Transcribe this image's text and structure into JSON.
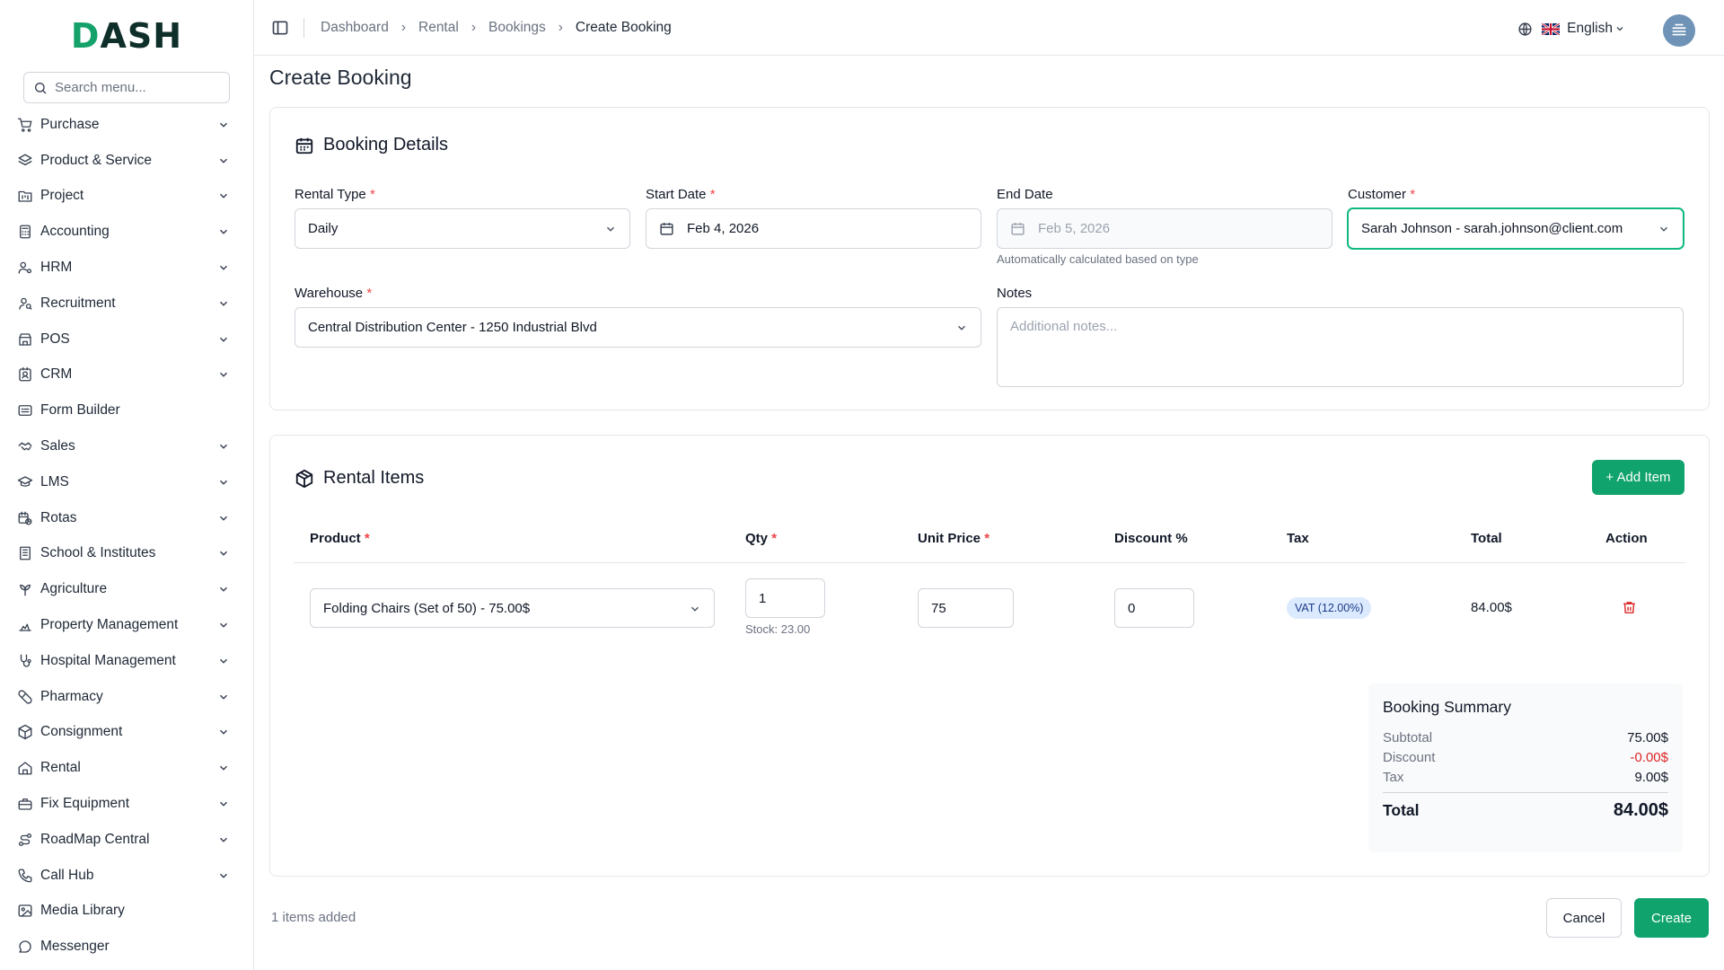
{
  "sidebar": {
    "logo": "DASH",
    "search_placeholder": "Search menu...",
    "items": [
      {
        "label": "Purchase",
        "icon": "cart-icon",
        "expandable": true
      },
      {
        "label": "Product & Service",
        "icon": "layers-icon",
        "expandable": true
      },
      {
        "label": "Project",
        "icon": "folder-kanban-icon",
        "expandable": true
      },
      {
        "label": "Accounting",
        "icon": "calculator-icon",
        "expandable": true
      },
      {
        "label": "HRM",
        "icon": "users-cog-icon",
        "expandable": true
      },
      {
        "label": "Recruitment",
        "icon": "user-search-icon",
        "expandable": true
      },
      {
        "label": "POS",
        "icon": "store-icon",
        "expandable": true
      },
      {
        "label": "CRM",
        "icon": "contact-icon",
        "expandable": true
      },
      {
        "label": "Form Builder",
        "icon": "form-icon",
        "expandable": false
      },
      {
        "label": "Sales",
        "icon": "handshake-icon",
        "expandable": true
      },
      {
        "label": "LMS",
        "icon": "graduation-cap-icon",
        "expandable": true
      },
      {
        "label": "Rotas",
        "icon": "calendar-clock-icon",
        "expandable": true
      },
      {
        "label": "School & Institutes",
        "icon": "school-icon",
        "expandable": true
      },
      {
        "label": "Agriculture",
        "icon": "sprout-icon",
        "expandable": true
      },
      {
        "label": "Property Management",
        "icon": "building-icon",
        "expandable": true
      },
      {
        "label": "Hospital Management",
        "icon": "stethoscope-icon",
        "expandable": true
      },
      {
        "label": "Pharmacy",
        "icon": "pill-icon",
        "expandable": true
      },
      {
        "label": "Consignment",
        "icon": "package-icon",
        "expandable": true
      },
      {
        "label": "Rental",
        "icon": "home-icon",
        "expandable": true
      },
      {
        "label": "Fix Equipment",
        "icon": "toolbox-icon",
        "expandable": true
      },
      {
        "label": "RoadMap Central",
        "icon": "route-icon",
        "expandable": true
      },
      {
        "label": "Call Hub",
        "icon": "phone-icon",
        "expandable": true
      },
      {
        "label": "Media Library",
        "icon": "image-icon",
        "expandable": false
      },
      {
        "label": "Messenger",
        "icon": "message-icon",
        "expandable": false
      }
    ]
  },
  "header": {
    "breadcrumbs": [
      "Dashboard",
      "Rental",
      "Bookings",
      "Create Booking"
    ],
    "language": "English"
  },
  "page": {
    "title": "Create Booking"
  },
  "booking_details": {
    "title": "Booking Details",
    "rental_type": {
      "label": "Rental Type",
      "value": "Daily"
    },
    "start_date": {
      "label": "Start Date",
      "value": "Feb 4, 2026"
    },
    "end_date": {
      "label": "End Date",
      "value": "Feb 5, 2026",
      "hint": "Automatically calculated based on type"
    },
    "customer": {
      "label": "Customer",
      "value": "Sarah Johnson - sarah.johnson@client.com"
    },
    "warehouse": {
      "label": "Warehouse",
      "value": "Central Distribution Center - 1250 Industrial Blvd"
    },
    "notes": {
      "label": "Notes",
      "placeholder": "Additional notes..."
    }
  },
  "rental_items": {
    "title": "Rental Items",
    "add_button": "+ Add Item",
    "columns": {
      "product": "Product",
      "qty": "Qty",
      "unit_price": "Unit Price",
      "discount": "Discount %",
      "tax": "Tax",
      "total": "Total",
      "action": "Action"
    },
    "rows": [
      {
        "product": "Folding Chairs (Set of 50) - 75.00$",
        "qty": "1",
        "stock": "Stock: 23.00",
        "unit_price": "75",
        "discount": "0",
        "tax": "VAT (12.00%)",
        "total": "84.00$"
      }
    ]
  },
  "summary": {
    "title": "Booking Summary",
    "subtotal_label": "Subtotal",
    "subtotal": "75.00$",
    "discount_label": "Discount",
    "discount": "-0.00$",
    "tax_label": "Tax",
    "tax": "9.00$",
    "total_label": "Total",
    "total": "84.00$"
  },
  "footer": {
    "items_added": "1 items added",
    "cancel": "Cancel",
    "create": "Create"
  },
  "colors": {
    "accent": "#10a36d",
    "danger": "#dc2626",
    "badge_bg": "#dbeafe"
  }
}
